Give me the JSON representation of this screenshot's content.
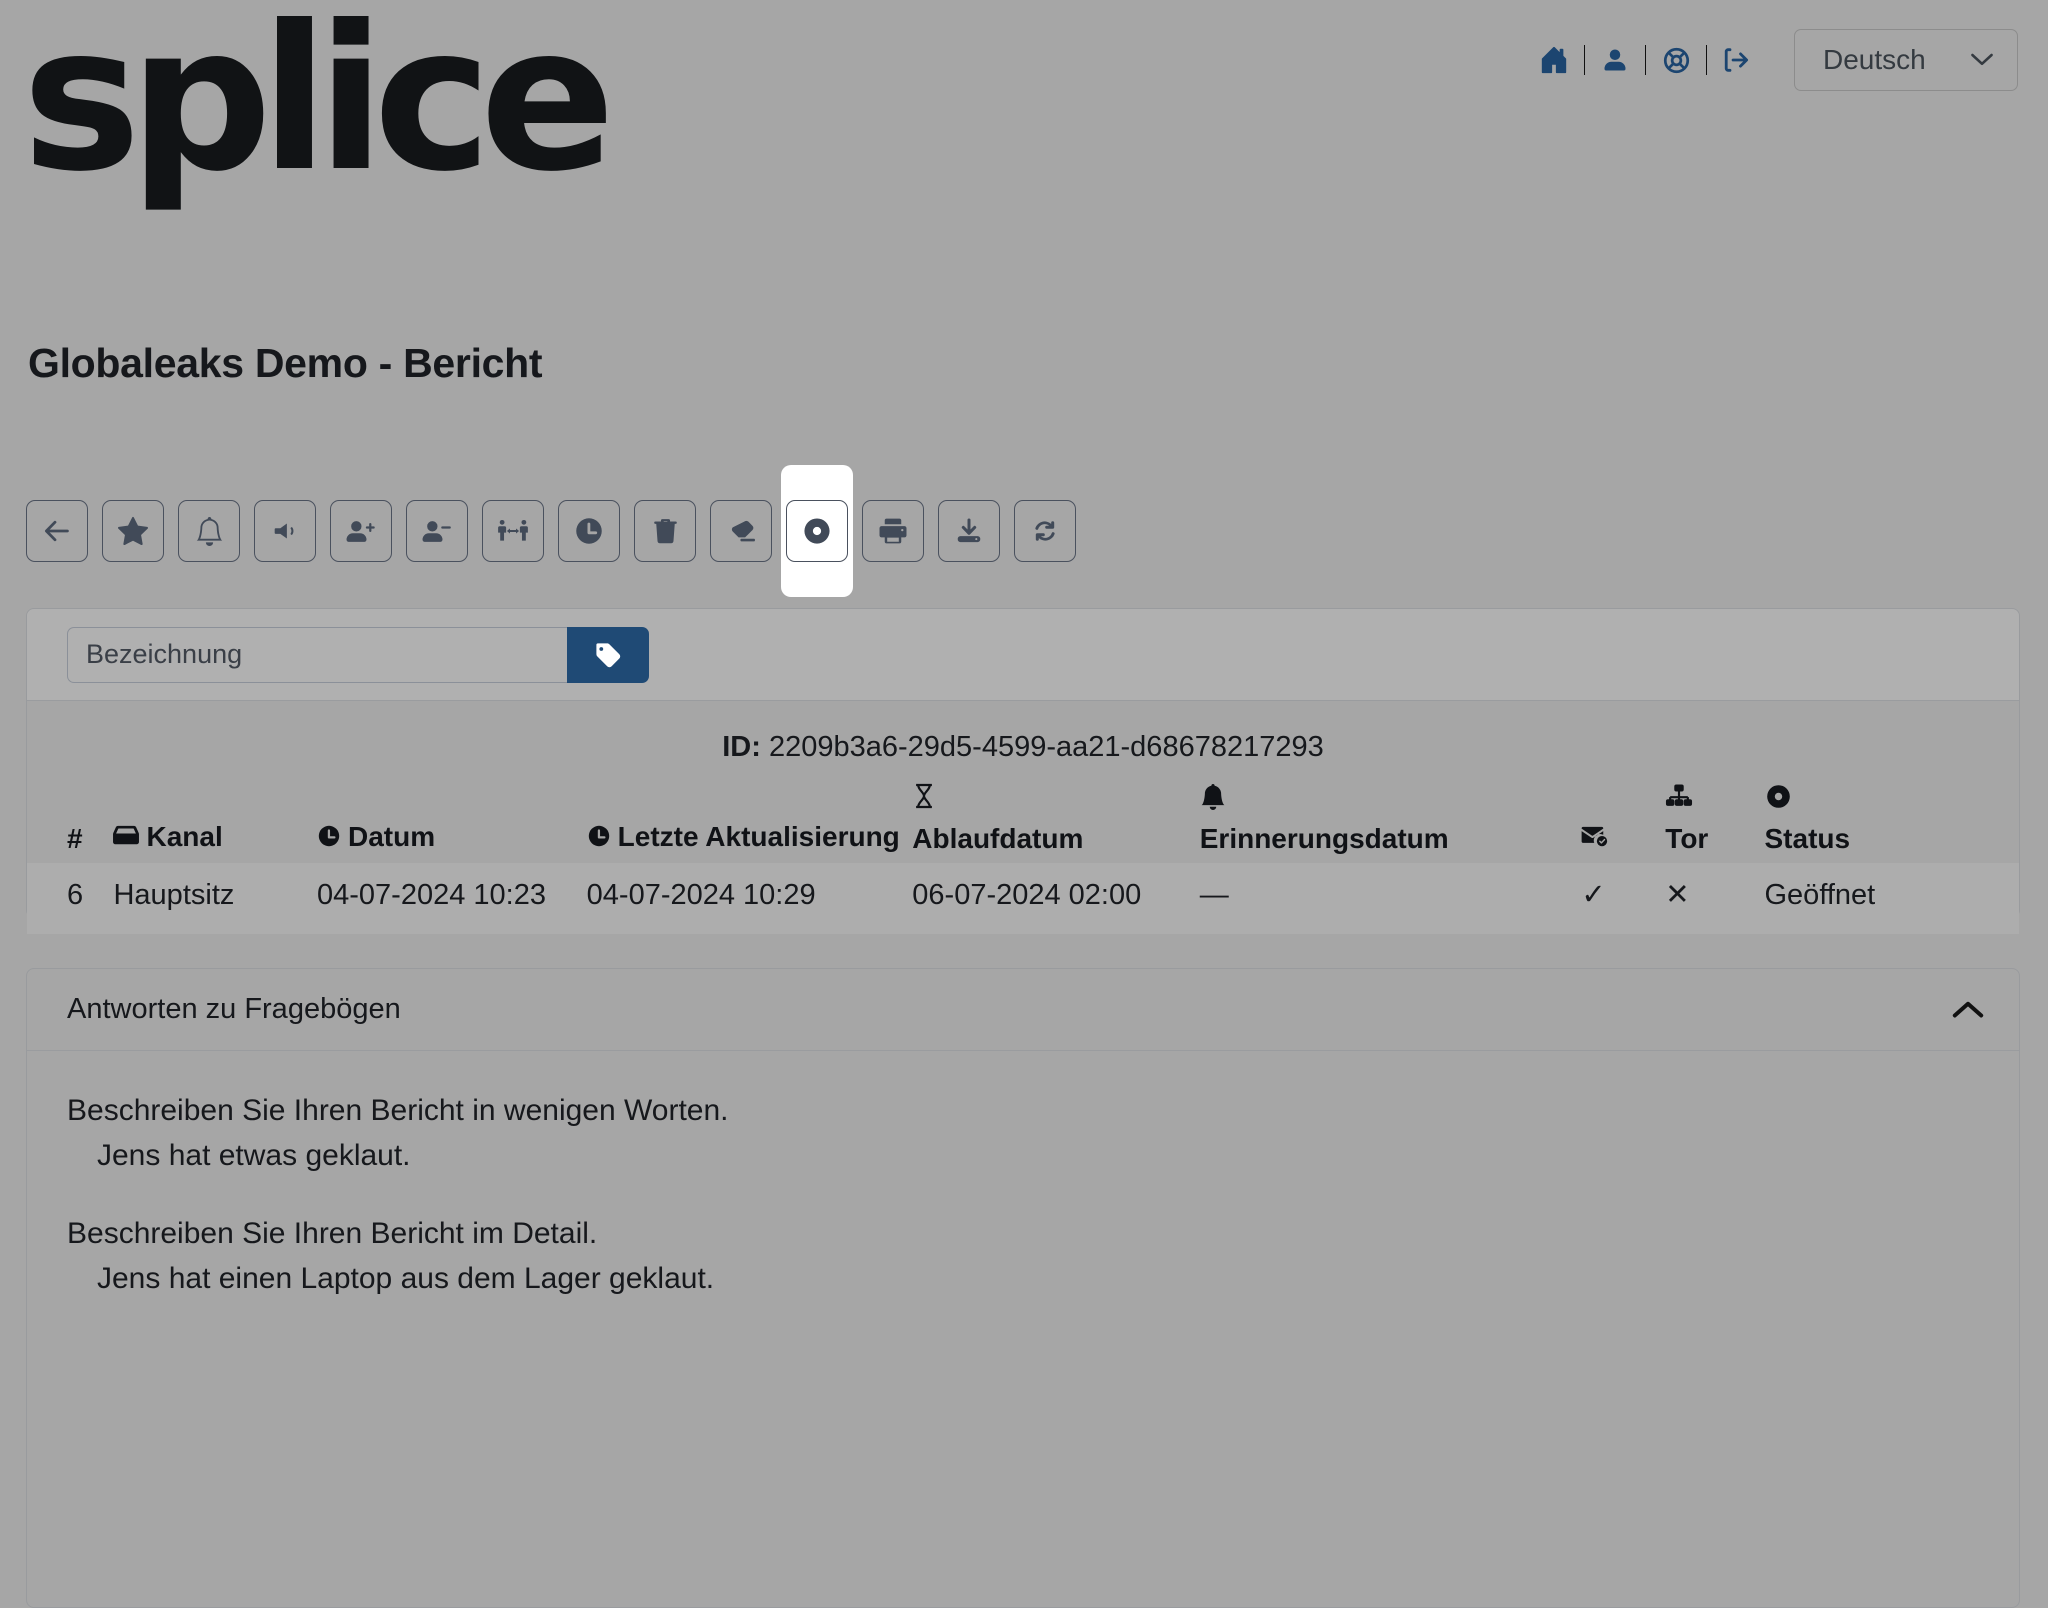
{
  "brand": {
    "logo_text": "splice"
  },
  "header": {
    "icons": [
      {
        "name": "home-icon",
        "label": "Home"
      },
      {
        "name": "user-icon",
        "label": "Benutzer"
      },
      {
        "name": "lifebuoy-icon",
        "label": "Hilfe"
      },
      {
        "name": "logout-icon",
        "label": "Abmelden"
      }
    ],
    "language": {
      "value": "Deutsch",
      "chevron": "⌄"
    }
  },
  "page": {
    "title": "Globaleaks Demo - Bericht"
  },
  "toolbar": {
    "buttons": [
      {
        "name": "back-button",
        "icon": "arrow-left-icon",
        "active": false
      },
      {
        "name": "star-button",
        "icon": "star-icon",
        "active": false
      },
      {
        "name": "bell-button",
        "icon": "bell-icon",
        "active": false
      },
      {
        "name": "speaker-button",
        "icon": "speaker-icon",
        "active": false
      },
      {
        "name": "add-recipient-button",
        "icon": "user-plus-icon",
        "active": false
      },
      {
        "name": "remove-recipient-button",
        "icon": "user-minus-icon",
        "active": false
      },
      {
        "name": "transfer-button",
        "icon": "people-arrows-icon",
        "active": false
      },
      {
        "name": "postpone-button",
        "icon": "clock-icon",
        "active": false
      },
      {
        "name": "delete-button",
        "icon": "trash-icon",
        "active": false
      },
      {
        "name": "redact-button",
        "icon": "eraser-icon",
        "active": false
      },
      {
        "name": "status-button",
        "icon": "record-circle-icon",
        "active": true
      },
      {
        "name": "print-button",
        "icon": "printer-icon",
        "active": false
      },
      {
        "name": "download-button",
        "icon": "download-icon",
        "active": false
      },
      {
        "name": "refresh-button",
        "icon": "refresh-icon",
        "active": false
      }
    ]
  },
  "report_card": {
    "tag_input": {
      "placeholder": "Bezeichnung",
      "value": ""
    },
    "tag_button_icon": "tag-icon",
    "id_label": "ID:",
    "id_value": "2209b3a6-29d5-4599-aa21-d68678217293",
    "columns": [
      {
        "key": "num",
        "label": "#",
        "icon": ""
      },
      {
        "key": "channel",
        "label": "Kanal",
        "icon": "inbox-icon"
      },
      {
        "key": "date",
        "label": "Datum",
        "icon": "clock-icon"
      },
      {
        "key": "last_update",
        "label": "Letzte Aktualisierung",
        "icon": "clock-icon"
      },
      {
        "key": "expiration",
        "label": "Ablaufdatum",
        "icon": "hourglass-icon"
      },
      {
        "key": "reminder",
        "label": "Erinnerungsdatum",
        "icon": "bell-icon"
      },
      {
        "key": "mail",
        "label": "",
        "icon": "mail-check-icon"
      },
      {
        "key": "tor",
        "label": "Tor",
        "icon": "network-icon"
      },
      {
        "key": "status",
        "label": "Status",
        "icon": "record-circle-icon"
      }
    ],
    "rows": [
      {
        "num": "6",
        "channel": "Hauptsitz",
        "date": "04-07-2024 10:23",
        "last_update": "04-07-2024 10:29",
        "expiration": "06-07-2024 02:00",
        "reminder": "—",
        "mail": "✓",
        "tor": "✕",
        "status": "Geöffnet"
      }
    ]
  },
  "answers_section": {
    "title": "Antworten zu Fragebögen",
    "collapse_icon": "chevron-up-icon",
    "items": [
      {
        "question": "Beschreiben Sie Ihren Bericht in wenigen Worten.",
        "answer": "Jens hat etwas geklaut."
      },
      {
        "question": "Beschreiben Sie Ihren Bericht im Detail.",
        "answer": "Jens hat einen Laptop aus dem Lager geklaut."
      }
    ]
  },
  "colors": {
    "page_background": "#a6a6a6",
    "accent_blue": "#1f4a75",
    "icon_blue": "#1c4570",
    "toolbar_icon": "#414a58",
    "text": "#16181c",
    "card_border": "#999b9e",
    "row_background": "#adadad",
    "highlight": "#ffffff"
  }
}
